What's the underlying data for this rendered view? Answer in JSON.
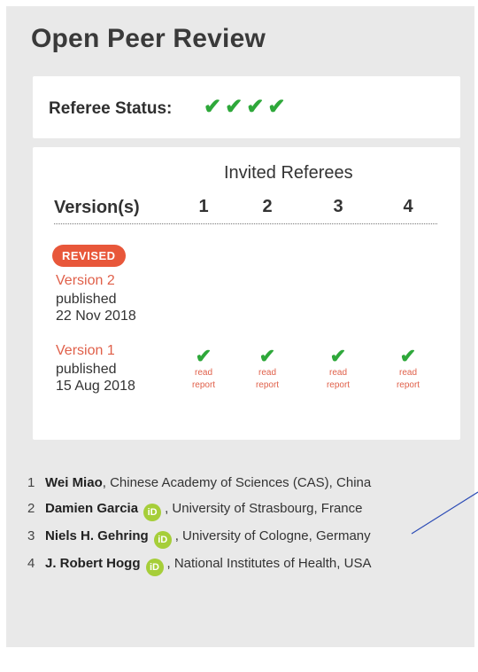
{
  "header": {
    "title": "Open Peer Review"
  },
  "referee_status": {
    "label": "Referee Status:",
    "checks": [
      "✔",
      "✔",
      "✔",
      "✔"
    ]
  },
  "table": {
    "invited_referees_label": "Invited Referees",
    "versions_header": "Version(s)",
    "columns": [
      "1",
      "2",
      "3",
      "4"
    ],
    "versions": [
      {
        "badge": "REVISED",
        "link": "Version 2",
        "status": "published",
        "date": "22 Nov 2018"
      },
      {
        "link": "Version 1",
        "status": "published",
        "date": "15 Aug 2018",
        "check_glyph": "✔",
        "reports": [
          "read report",
          "read report",
          "read report",
          "read report"
        ]
      }
    ]
  },
  "referees": [
    {
      "num": "1",
      "name": "Wei Miao",
      "affiliation": ", Chinese Academy of Sciences (CAS), China",
      "orcid": false
    },
    {
      "num": "2",
      "name": "Damien Garcia",
      "affiliation": ", University of Strasbourg, France",
      "orcid": true
    },
    {
      "num": "3",
      "name": "Niels H. Gehring",
      "affiliation": ", University of Cologne, Germany",
      "orcid": true
    },
    {
      "num": "4",
      "name": "J. Robert Hogg",
      "affiliation": ", National Institutes of Health, USA",
      "orcid": true
    }
  ],
  "orcid_label": "iD",
  "colors": {
    "check": "#2ea83a",
    "badge": "#e8573a",
    "link": "#e0604a",
    "orcid": "#a6ce39"
  }
}
